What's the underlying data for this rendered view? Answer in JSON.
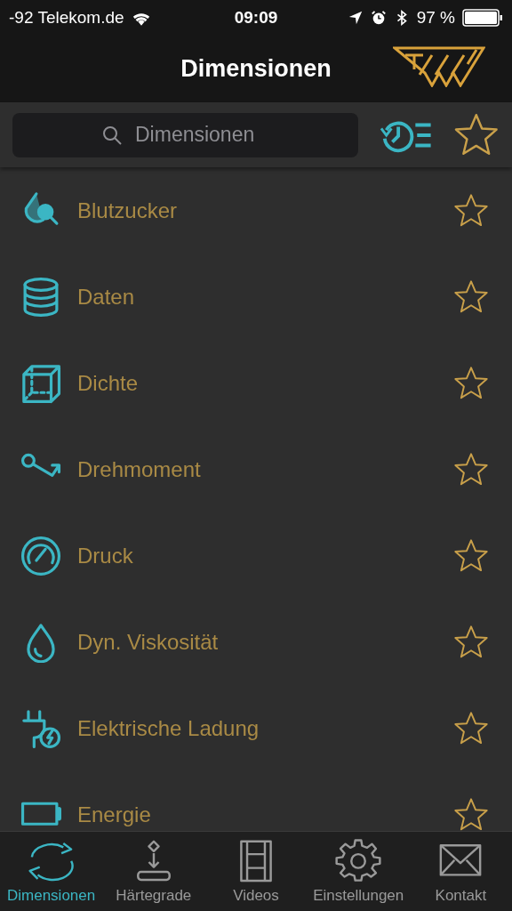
{
  "status_bar": {
    "carrier": "-92 Telekom.de",
    "time": "09:09",
    "battery": "97 %"
  },
  "nav_bar": {
    "title": "Dimensionen"
  },
  "search": {
    "placeholder": "Dimensionen"
  },
  "favorites_filter": {
    "selected": false
  },
  "items": [
    {
      "label": "Blutzucker",
      "favorite": false
    },
    {
      "label": "Daten",
      "favorite": false
    },
    {
      "label": "Dichte",
      "favorite": false
    },
    {
      "label": "Drehmoment",
      "favorite": false
    },
    {
      "label": "Druck",
      "favorite": false
    },
    {
      "label": "Dyn. Viskosität",
      "favorite": false
    },
    {
      "label": "Elektrische Ladung",
      "favorite": false
    },
    {
      "label": "Energie",
      "favorite": false
    }
  ],
  "tab_bar": [
    {
      "label": "Dimensionen",
      "selected": true
    },
    {
      "label": "Härtegrade",
      "selected": false
    },
    {
      "label": "Videos",
      "selected": false
    },
    {
      "label": "Einstellungen",
      "selected": false
    },
    {
      "label": "Kontakt",
      "selected": false
    }
  ]
}
